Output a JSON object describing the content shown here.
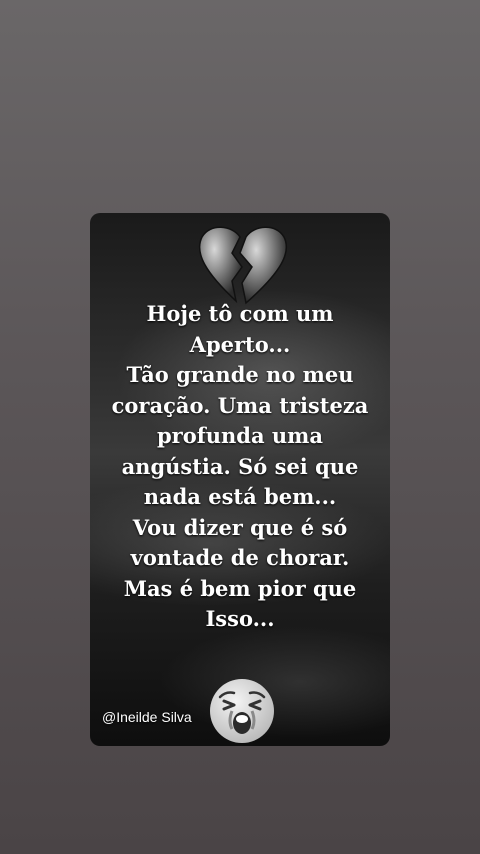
{
  "poem": {
    "lines": [
      "Hoje tô com um",
      "Aperto...",
      "Tão grande no meu",
      "coração. Uma tristeza",
      "profunda uma",
      "angústia. Só sei que",
      "nada está bem...",
      "Vou dizer que é só",
      "vontade de chorar.",
      "Mas é bem pior que",
      "Isso..."
    ]
  },
  "signature": "@Ineilde Silva",
  "icons": {
    "top": "broken-heart-icon",
    "bottom": "crying-face-emoji"
  },
  "colors": {
    "text": "#ffffff",
    "background": "#5c5759",
    "card": "#1e1e1e"
  }
}
